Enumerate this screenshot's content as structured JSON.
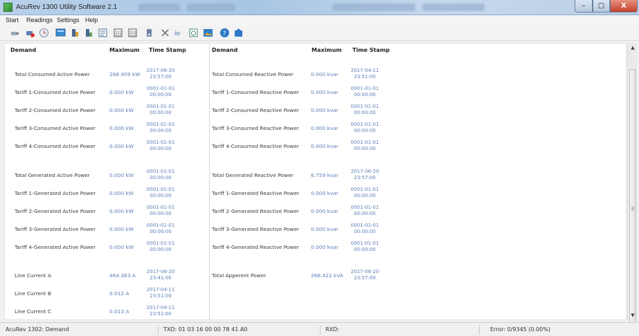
{
  "window": {
    "title": "AcuRev 1300 Utility Software 2.1",
    "controls": {
      "minimize": "–",
      "maximize": "▢",
      "close": "X"
    }
  },
  "menu": [
    "Start",
    "Readings",
    "Settings",
    "Help"
  ],
  "toolbar_icons": [
    "disconnect-icon",
    "connect-icon",
    "clock-icon",
    "monitor-icon",
    "meter-icon",
    "meter-alt-icon",
    "log-icon",
    "calendar-icon",
    "calendar-alt-icon",
    "device-icon",
    "tools-icon",
    "io-icon",
    "event-icon",
    "image-icon",
    "help-icon",
    "update-icon"
  ],
  "table": {
    "headers": {
      "demand": "Demand",
      "maximum": "Maximum",
      "timestamp": "Time Stamp"
    },
    "left": [
      {
        "name": "Total Consumed Active Power",
        "value": "268.409 kW",
        "date": "2017-06-20",
        "time": "23:57:00"
      },
      {
        "name": "Tariff 1-Consumed Active Power",
        "value": "0.000 kW",
        "date": "0001-01-01",
        "time": "00:00:00"
      },
      {
        "name": "Tariff 2-Consumed Active Power",
        "value": "0.000 kW",
        "date": "0001-01-01",
        "time": "00:00:00"
      },
      {
        "name": "Tariff 3-Consumed Active Power",
        "value": "0.000 kW",
        "date": "0001-01-01",
        "time": "00:00:00"
      },
      {
        "name": "Tariff 4-Consumed Active Power",
        "value": "0.000 kW",
        "date": "0001-01-01",
        "time": "00:00:00"
      },
      {
        "name": "Total Generated Active Power",
        "value": "0.000 kW",
        "date": "0001-01-01",
        "time": "00:00:00"
      },
      {
        "name": "Tariff 1-Generated Active Power",
        "value": "0.000 kW",
        "date": "0001-01-01",
        "time": "00:00:00"
      },
      {
        "name": "Tariff 2-Generated Active Power",
        "value": "0.000 kW",
        "date": "0001-01-01",
        "time": "00:00:00"
      },
      {
        "name": "Tariff 3-Generated Active Power",
        "value": "0.000 kW",
        "date": "0001-01-01",
        "time": "00:00:00"
      },
      {
        "name": "Tariff 4-Generated Active Power",
        "value": "0.000 kW",
        "date": "0001-01-01",
        "time": "00:00:00"
      },
      {
        "name": "Line Current A",
        "value": "464.363 A",
        "date": "2017-06-20",
        "time": "23:41:00"
      },
      {
        "name": "Line Current B",
        "value": "0.012 A",
        "date": "2017-04-11",
        "time": "23:51:00"
      },
      {
        "name": "Line Current C",
        "value": "0.013 A",
        "date": "2017-04-11",
        "time": "23:51:00"
      }
    ],
    "right": [
      {
        "name": "Total Consumed Reactive Power",
        "value": "0.000 kvar",
        "date": "2017-04-11",
        "time": "23:51:00"
      },
      {
        "name": "Tariff 1-Consumed Reactive Power",
        "value": "0.000 kvar",
        "date": "0001-01-01",
        "time": "00:00:00"
      },
      {
        "name": "Tariff 2-Consumed Reactive Power",
        "value": "0.000 kvar",
        "date": "0001-01-01",
        "time": "00:00:00"
      },
      {
        "name": "Tariff 3-Consumed Reactive Power",
        "value": "0.000 kvar",
        "date": "0001-01-01",
        "time": "00:00:00"
      },
      {
        "name": "Tariff 4-Consumed Reactive Power",
        "value": "0.000 kvar",
        "date": "0001-01-01",
        "time": "00:00:00"
      },
      {
        "name": "Total Generated Reactive Power",
        "value": "6.759 kvar",
        "date": "2017-06-20",
        "time": "23:57:00"
      },
      {
        "name": "Tariff 1-Generated Reactive Power",
        "value": "0.000 kvar",
        "date": "0001-01-01",
        "time": "00:00:00"
      },
      {
        "name": "Tariff 2-Generated Reactive Power",
        "value": "0.000 kvar",
        "date": "0001-01-01",
        "time": "00:00:00"
      },
      {
        "name": "Tariff 3-Generated Reactive Power",
        "value": "0.000 kvar",
        "date": "0001-01-01",
        "time": "00:00:00"
      },
      {
        "name": "Tariff 4-Generated Reactive Power",
        "value": "0.000 kvar",
        "date": "0001-01-01",
        "time": "00:00:00"
      },
      {
        "name": "Total Apperent Power",
        "value": "268.422 kVA",
        "date": "2017-06-20",
        "time": "23:57:00"
      }
    ]
  },
  "status": {
    "device": "AcuRev 1302: Demand",
    "txd": "TXD:  01 03 16 00 00 78 41 A0",
    "rxd": "RXD:",
    "error": "Error:  0/9345  (0.00%)"
  },
  "colors": {
    "value": "#5b7fb8",
    "label": "#3a3a3a",
    "accent": "#2f8f2f"
  }
}
